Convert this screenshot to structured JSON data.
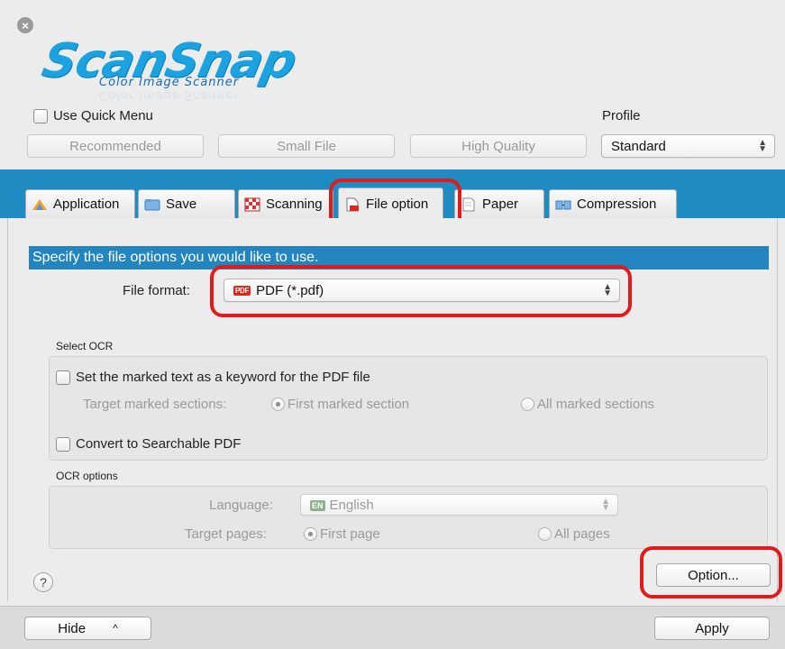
{
  "window": {
    "close_glyph": "×"
  },
  "logo": {
    "title": "ScanSnap",
    "subtitle": "Color Image Scanner"
  },
  "top": {
    "quick_menu_label": "Use Quick Menu",
    "profile_label": "Profile",
    "presets": [
      "Recommended",
      "Small File",
      "High Quality"
    ],
    "profile_value": "Standard"
  },
  "tabs": [
    {
      "label": "Application",
      "icon": "application-icon"
    },
    {
      "label": "Save",
      "icon": "folder-icon"
    },
    {
      "label": "Scanning",
      "icon": "scanning-icon"
    },
    {
      "label": "File option",
      "icon": "file-option-icon",
      "active": true
    },
    {
      "label": "Paper",
      "icon": "paper-icon"
    },
    {
      "label": "Compression",
      "icon": "compression-icon"
    }
  ],
  "panel": {
    "instruction": "Specify the file options you would like to use.",
    "file_format_label": "File format:",
    "file_format_value": "PDF (*.pdf)",
    "pdf_badge": "PDF",
    "select_ocr_label": "Select OCR",
    "keyword_label": "Set the marked text as a keyword for the PDF file",
    "target_marked_label": "Target marked sections:",
    "first_marked": "First marked section",
    "all_marked": "All marked sections",
    "searchable_label": "Convert to Searchable PDF",
    "ocr_options_label": "OCR options",
    "language_label": "Language:",
    "language_value": "English",
    "en_badge": "EN",
    "target_pages_label": "Target pages:",
    "first_page": "First page",
    "all_pages": "All pages",
    "option_button": "Option..."
  },
  "bottom": {
    "help_glyph": "?",
    "hide_label": "Hide",
    "hide_chevron": "^",
    "apply_label": "Apply"
  },
  "colors": {
    "accent": "#1e8bc3",
    "instruction_bar": "#2285bf",
    "highlight": "#e11b1b",
    "logo": "#1aa3e0"
  }
}
